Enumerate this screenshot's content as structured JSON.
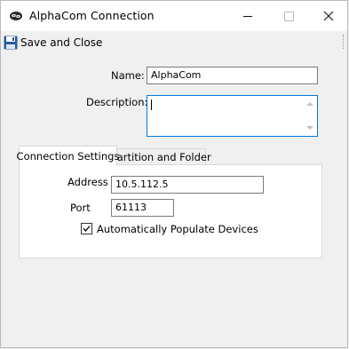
{
  "window": {
    "title": "AlphaCom Connection"
  },
  "toolbar": {
    "save_close_label": "Save and Close"
  },
  "form": {
    "name_label": "Name:",
    "name_value": "AlphaCom",
    "description_label": "Description:",
    "description_value": ""
  },
  "tabs": [
    {
      "label": "Connection Settings",
      "selected": true
    },
    {
      "label": "Partition and Folder",
      "selected": false
    }
  ],
  "connection": {
    "address_label": "Address",
    "address_value": "10.5.112.5",
    "port_label": "Port",
    "port_value": "61113",
    "auto_populate_label": "Automatically Populate Devices",
    "auto_populate_checked": true
  }
}
